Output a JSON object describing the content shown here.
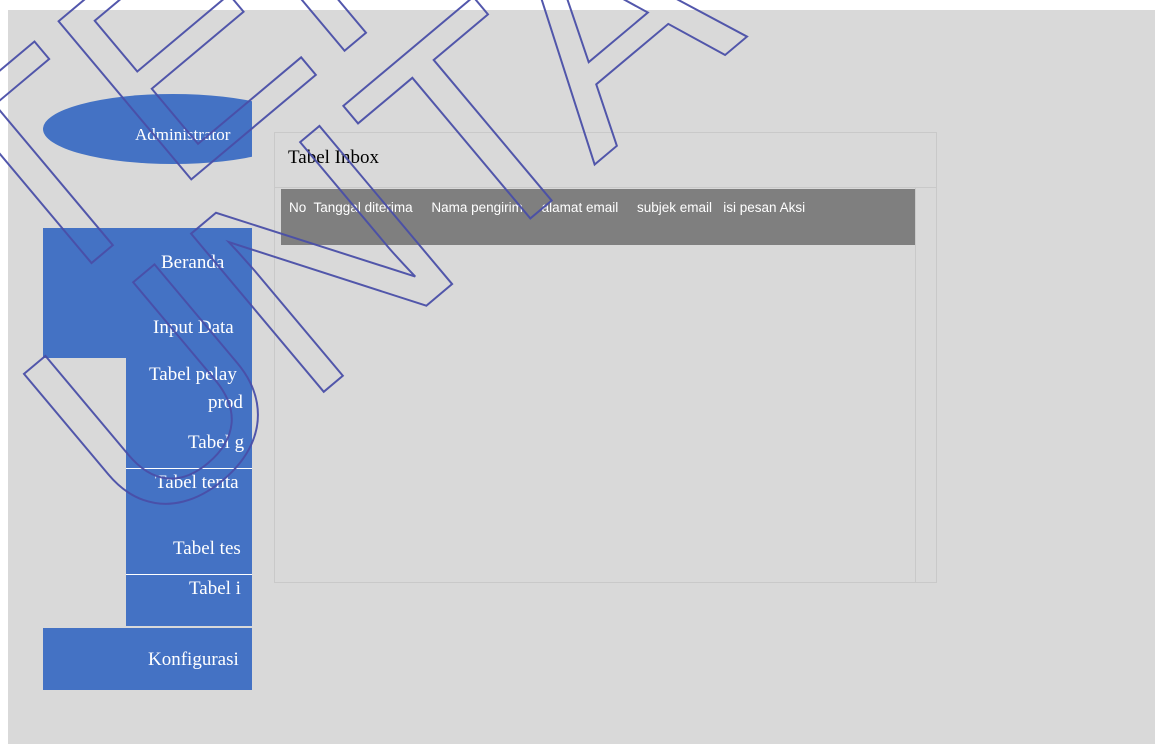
{
  "sidebar": {
    "admin_label": "Administrator",
    "items": [
      {
        "label": "Beranda"
      },
      {
        "label": "Input Data"
      },
      {
        "label": "Tabel pelay"
      },
      {
        "label": "prod"
      },
      {
        "label": "Tabel g"
      },
      {
        "label": "Tabel tenta"
      },
      {
        "label": "Tabel tes"
      },
      {
        "label": "Tabel i"
      },
      {
        "label": "Konfigurasi"
      }
    ]
  },
  "main": {
    "title": "Tabel Inbox",
    "table": {
      "columns": [
        "No",
        "Tanggal diterima",
        "Nama pengirim",
        "alamat email",
        "subjek email",
        "isi pesan",
        "Aksi"
      ],
      "rows": []
    }
  },
  "watermark": {
    "text_1": "TEKNIK",
    "text_2": "UNTAG SBY",
    "color": "#4a4fa8"
  },
  "colors": {
    "nav_blue": "#4472c4",
    "background": "#d9d9d9",
    "table_header": "#7f7f7f"
  }
}
